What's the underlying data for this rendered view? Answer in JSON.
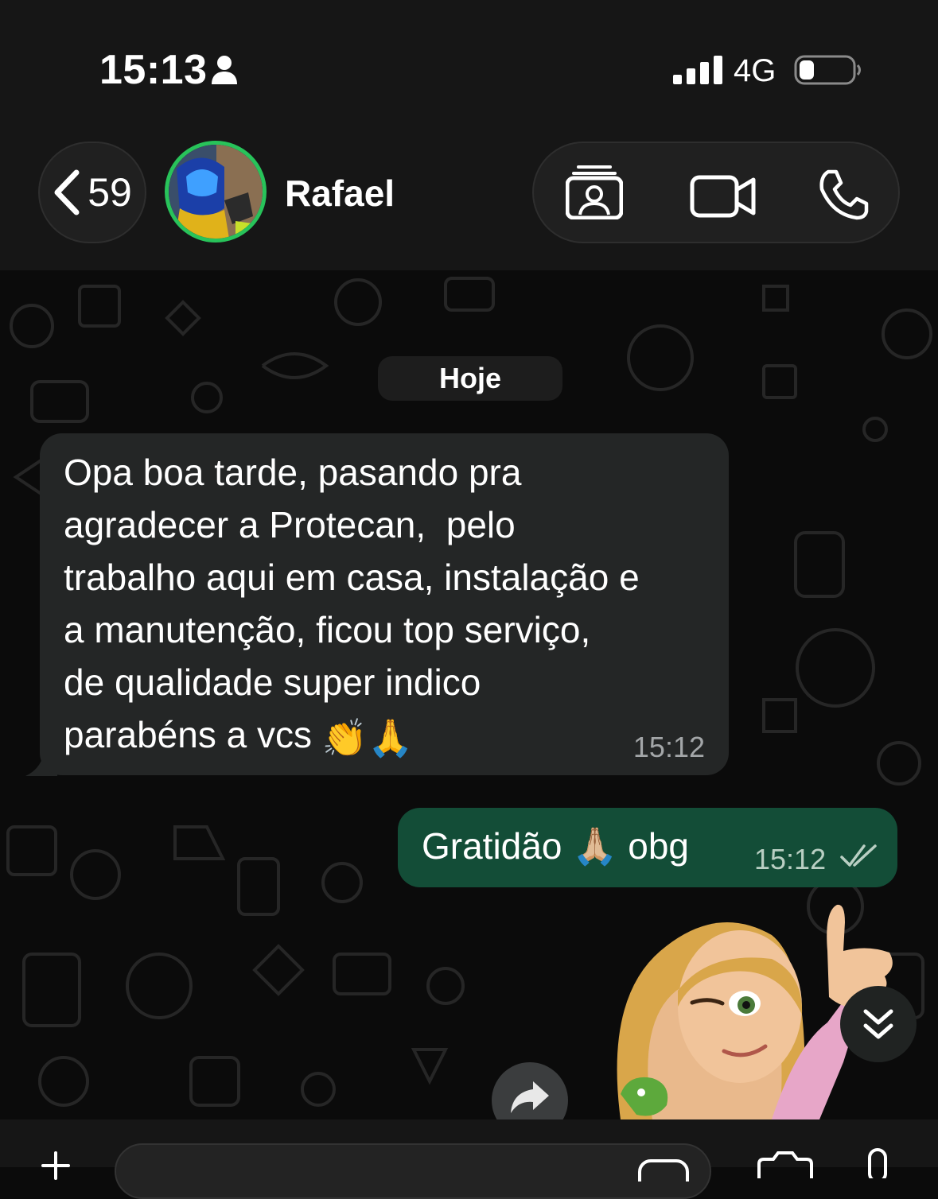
{
  "status_bar": {
    "time": "15:13",
    "network": "4G",
    "icons": [
      "person-icon",
      "signal-bars-icon",
      "battery-icon"
    ]
  },
  "header": {
    "back_count": "59",
    "contact_name": "Rafael",
    "icons": [
      "back-chevron-icon",
      "contact-card-icon",
      "video-camera-icon",
      "phone-icon"
    ]
  },
  "chat": {
    "date_chip": "Hoje",
    "messages": [
      {
        "direction": "incoming",
        "text": "Opa boa tarde, pasando pra\nagradecer a Protecan,  pelo\ntrabalho aqui em casa, instalação e\na manutenção, ficou top serviço,\nde qualidade super indico\nparabéns a vcs ",
        "emojis": "👏🙏",
        "time": "15:12"
      },
      {
        "direction": "outgoing",
        "text": "Gratidão 🙏🏼 obg",
        "time": "15:12",
        "status": "read"
      }
    ],
    "sticker": "winking-girl-thumbs-up-sticker"
  },
  "composer": {
    "placeholder": "",
    "icons": [
      "plus-icon",
      "sticker-icon",
      "camera-icon",
      "microphone-icon"
    ]
  },
  "colors": {
    "background": "#0b0b0b",
    "bar": "#161616",
    "incoming_bubble": "#242626",
    "outgoing_bubble": "#134d37",
    "avatar_ring": "#28c35a",
    "timestamp": "#a3a6a8"
  }
}
